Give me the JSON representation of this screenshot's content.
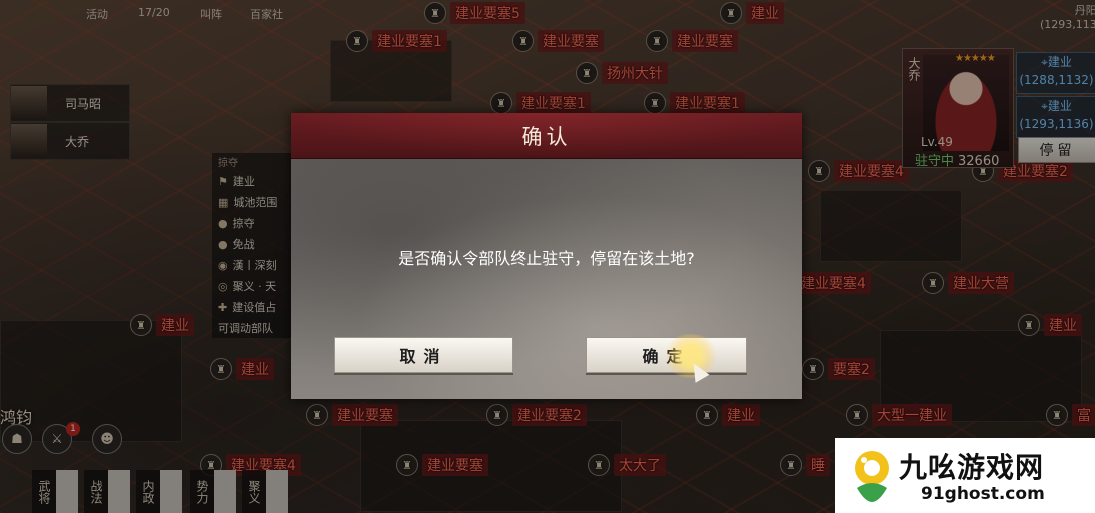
{
  "top_bar": {
    "items": [
      "活动",
      "17/20",
      "叫阵",
      "百家社"
    ],
    "top_right": [
      "丹阳",
      "(1293,113"
    ]
  },
  "map_labels": [
    {
      "text": "建业要塞5"
    },
    {
      "text": "建业"
    },
    {
      "text": "建业要塞1"
    },
    {
      "text": "建业要塞"
    },
    {
      "text": "建业要塞"
    },
    {
      "text": "扬州大针"
    },
    {
      "text": "建业要塞1"
    },
    {
      "text": "建业要塞1"
    },
    {
      "text": "建业要塞4"
    },
    {
      "text": "建业要塞2"
    },
    {
      "text": "建业要塞4"
    },
    {
      "text": "建业大营"
    },
    {
      "text": "建业"
    },
    {
      "text": "建业"
    },
    {
      "text": "建业"
    },
    {
      "text": "要塞2"
    },
    {
      "text": "建业要塞"
    },
    {
      "text": "建业要塞2"
    },
    {
      "text": "建业"
    },
    {
      "text": "大型一建业"
    },
    {
      "text": "富"
    },
    {
      "text": "建业要塞4"
    },
    {
      "text": "建业要塞"
    },
    {
      "text": "太大了"
    },
    {
      "text": "睡"
    }
  ],
  "left_heroes": [
    {
      "name": "司马昭"
    },
    {
      "name": "大乔"
    }
  ],
  "info_panel": {
    "header": "掠夺",
    "rows": [
      "建业",
      "城池范围",
      "掠夺",
      "免战",
      "漢丨深刻",
      "聚义 · 天",
      "建设值占",
      "可调动部队"
    ]
  },
  "bottom_left": {
    "name": "鸿钧",
    "badge": "1",
    "tabs": [
      "武将",
      "战法",
      "内政",
      "势力",
      "聚义"
    ]
  },
  "hero_card": {
    "name": "大乔",
    "level": "Lv.49",
    "status": "驻守中",
    "troops": "32660",
    "stars": "★★★★★"
  },
  "locations": [
    {
      "name": "建业",
      "coord": "(1288,1132)"
    },
    {
      "name": "建业",
      "coord": "(1293,1136)"
    }
  ],
  "stay_button": "停留",
  "modal": {
    "title": "确认",
    "message": "是否确认令部队终止驻守，停留在该土地?",
    "cancel_label": "取消",
    "confirm_label": "确定"
  },
  "watermark": {
    "title": "九吆游戏网",
    "url": "91ghost.com"
  },
  "colors": {
    "title_bar": "#6a1d22",
    "map_label": "#ff6a55",
    "status_green": "#6fd26f",
    "location_blue": "#7fc9ff"
  }
}
